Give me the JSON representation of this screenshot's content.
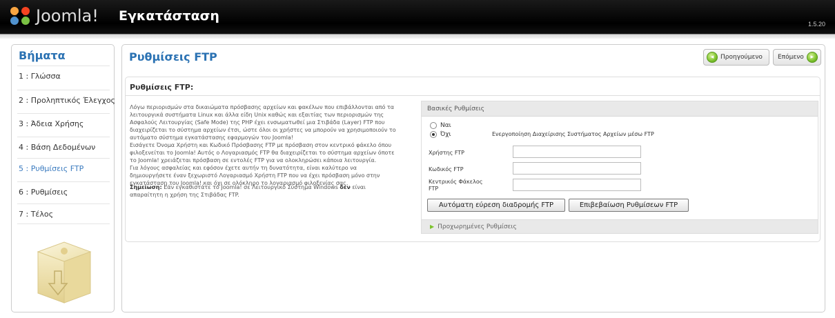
{
  "header": {
    "brand": "Joomla!",
    "title": "Εγκατάσταση",
    "version": "1.5.20"
  },
  "sidebar": {
    "title": "Βήματα",
    "steps": [
      {
        "label": "1 : Γλώσσα"
      },
      {
        "label": "2 : Προληπτικός Έλεγχος"
      },
      {
        "label": "3 : Άδεια Χρήσης"
      },
      {
        "label": "4 : Βάση Δεδομένων"
      },
      {
        "label": "5 : Ρυθμίσεις FTP"
      },
      {
        "label": "6 : Ρυθμίσεις"
      },
      {
        "label": "7 : Τέλος"
      }
    ],
    "active_step": 5
  },
  "main": {
    "title": "Ρυθμίσεις FTP",
    "prev_label": "Προηγούμενο",
    "next_label": "Επόμενο",
    "section_title": "Ρυθμίσεις FTP:",
    "description": [
      "Λόγω περιορισμών στα δικαιώματα πρόσβασης αρχείων και φακέλων που επιβάλλονται από τα",
      "λειτουργικά συστήματα Linux και άλλα είδη Unix καθώς και εξαιτίας των περιορισμών της",
      "Ασφαλούς Λειτουργίας (Safe Mode) της PHP έχει ενσωματωθεί μια Στιβάδα (Layer) FTP που",
      "διαχειρίζεται το σύστημα αρχείων έτσι, ώστε όλοι οι χρήστες να μπορούν να χρησιμοποιούν το",
      "αυτόματο σύστημα εγκατάστασης εφαρμογών του Joomla!",
      "Εισάγετε Όνομα Χρήστη και Κωδικό Πρόσβασης FTP με πρόσβαση στον κεντρικό φάκελο όπου",
      "φιλοξενείται το Joomla! Αυτός ο Λογαριασμός FTP θα διαχειρίζεται το σύστημα αρχείων όποτε",
      "το Joomla! χρειάζεται πρόσβαση σε εντολές FTP για να ολοκληρώσει κάποια λειτουργία.",
      "Για λόγους ασφαλείας και εφόσον έχετε αυτήν τη δυνατότητα, είναι καλύτερο να",
      "δημιουργήσετε έναν ξεχωριστό Λογαριασμό Χρήστη FTP που να έχει πρόσβαση μόνο στην",
      "εγκατάσταση του Joomla! και όχι σε ολόκληρο το λογαριασμό φιλοξενίας σας."
    ],
    "note_label": "Σημείωση:",
    "note_text_1": " Εάν εγκαθιστάτε το Joomla! σε Λειτουργικό Σύστημα Windows ",
    "note_bold": "δεν",
    "note_text_2": " είναι",
    "note_text_3": "απαραίτητη η χρήση της Στιβάδας FTP.",
    "basic": {
      "title": "Βασικές Ρυθμίσεις",
      "yes_label": "Ναι",
      "no_label": "Όχι",
      "selected": "Όχι",
      "enable_label": "Ενεργοποίηση Διαχείρισης Συστήματος Αρχείων μέσω FTP",
      "user_label": "Χρήστης FTP",
      "user_value": "",
      "pass_label": "Κωδικός FTP",
      "pass_value": "",
      "root_label": "Κεντρικός Φάκελος FTP",
      "root_value": "",
      "auto_button": "Αυτόματη εύρεση διαδρομής FTP",
      "verify_button": "Επιβεβαίωση Ρυθμίσεων FTP"
    },
    "advanced": {
      "title": "Προχωρημένες Ρυθμίσεις"
    }
  },
  "colors": {
    "accent": "#2b72b3",
    "header_bg": "#000000",
    "button_green": "#7cc22c"
  }
}
